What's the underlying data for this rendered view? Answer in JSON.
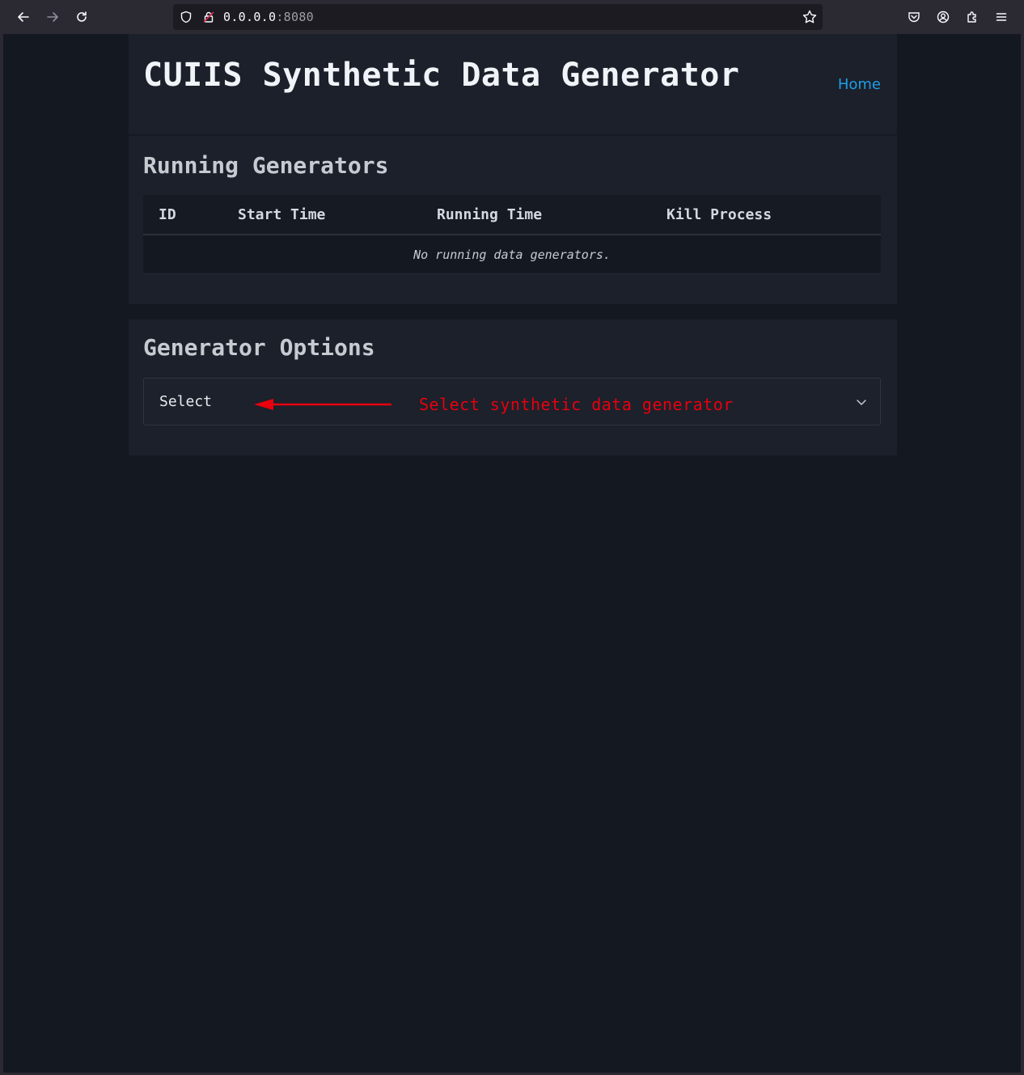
{
  "browser": {
    "url_host": "0.0.0.0",
    "url_port": ":8080",
    "icons": [
      "back-icon",
      "forward-icon",
      "reload-icon",
      "shield-icon",
      "lock-icon",
      "star-icon",
      "pocket-icon",
      "account-icon",
      "extensions-icon",
      "menu-icon"
    ]
  },
  "header": {
    "title": "CUIIS Synthetic Data Generator",
    "home_link": "Home"
  },
  "running": {
    "title": "Running Generators",
    "columns": [
      "ID",
      "Start Time",
      "Running Time",
      "Kill Process"
    ],
    "empty_message": "No running data generators."
  },
  "options": {
    "title": "Generator Options",
    "select_value": "Select",
    "annotation": "Select synthetic data generator"
  },
  "colors": {
    "background": "#141821",
    "card": "#1b202a",
    "link": "#1e9ee6",
    "annotation": "#e8000e"
  }
}
